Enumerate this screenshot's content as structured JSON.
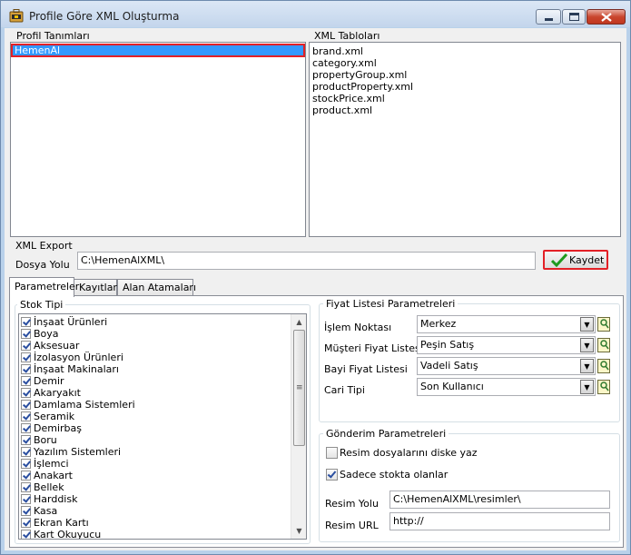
{
  "window": {
    "title": "Profile Göre XML Oluşturma",
    "icon": "briefcase-icon",
    "controls": [
      "minimize-icon",
      "maximize-icon",
      "close-icon"
    ]
  },
  "profiles": {
    "label": "Profil Tanımları",
    "items": [
      "HemenAl"
    ],
    "selected": "HemenAl"
  },
  "xml_tables": {
    "label": "XML Tabloları",
    "items": [
      "brand.xml",
      "category.xml",
      "propertyGroup.xml",
      "productProperty.xml",
      "stockPrice.xml",
      "product.xml"
    ]
  },
  "export": {
    "section_label": "XML Export",
    "path_label": "Dosya Yolu",
    "path_value": "C:\\HemenAlXML\\",
    "save_label": "Kaydet",
    "save_icon": "green-check-icon"
  },
  "tabs": [
    "Parametreler",
    "Kayıtlar",
    "Alan Atamaları"
  ],
  "active_tab": "Parametreler",
  "stock_types": {
    "label": "Stok Tipi",
    "items": [
      {
        "label": "İnşaat Ürünleri",
        "checked": true
      },
      {
        "label": "Boya",
        "checked": true
      },
      {
        "label": "Aksesuar",
        "checked": true
      },
      {
        "label": "İzolasyon Ürünleri",
        "checked": true
      },
      {
        "label": "İnşaat Makinaları",
        "checked": true
      },
      {
        "label": "Demir",
        "checked": true
      },
      {
        "label": "Akaryakıt",
        "checked": true
      },
      {
        "label": "Damlama Sistemleri",
        "checked": true
      },
      {
        "label": "Seramik",
        "checked": true
      },
      {
        "label": "Demirbaş",
        "checked": true
      },
      {
        "label": "Boru",
        "checked": true
      },
      {
        "label": "Yazılım Sistemleri",
        "checked": true
      },
      {
        "label": "İşlemci",
        "checked": true
      },
      {
        "label": "Anakart",
        "checked": true
      },
      {
        "label": "Bellek",
        "checked": true
      },
      {
        "label": "Harddisk",
        "checked": true
      },
      {
        "label": "Kasa",
        "checked": true
      },
      {
        "label": "Ekran Kartı",
        "checked": true
      },
      {
        "label": "Kart Okuyucu",
        "checked": true
      }
    ]
  },
  "price_params": {
    "label": "Fiyat Listesi Parametreleri",
    "fields": [
      {
        "label": "İşlem Noktası",
        "value": "Merkez"
      },
      {
        "label": "Müşteri Fiyat Listesi",
        "value": "Peşin Satış"
      },
      {
        "label": "Bayi Fiyat Listesi",
        "value": "Vadeli Satış"
      },
      {
        "label": "Cari Tipi",
        "value": "Son Kullanıcı"
      }
    ],
    "lookup_icon": "lookup-icon"
  },
  "send_params": {
    "label": "Gönderim Parametreleri",
    "options": [
      {
        "label": "Resim dosyalarını diske yaz",
        "checked": false
      },
      {
        "label": "Sadece stokta olanlar",
        "checked": true
      }
    ],
    "image_path_label": "Resim Yolu",
    "image_path_value": "C:\\HemenAlXML\\resimler\\",
    "image_url_label": "Resim URL",
    "image_url_value": "http://"
  }
}
